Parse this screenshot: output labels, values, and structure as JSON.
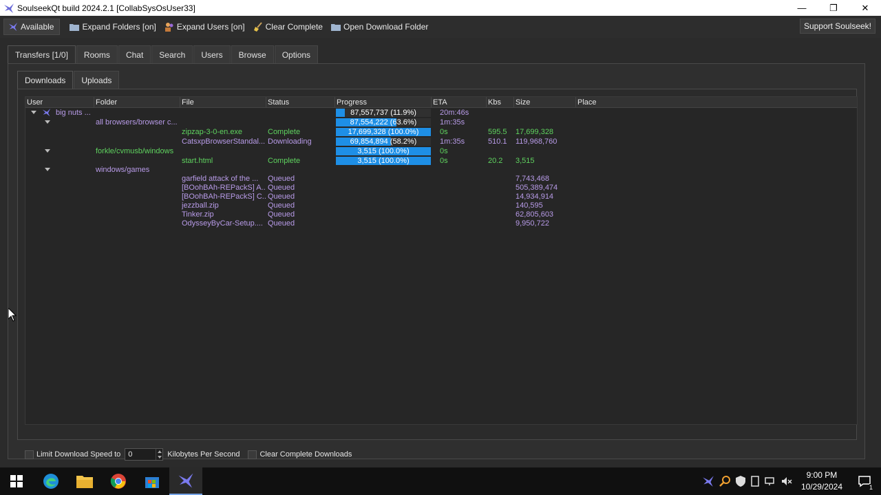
{
  "window": {
    "title": "SoulseekQt build 2024.2.1 [CollabSysOsUser33]",
    "minimize": "—",
    "maximize": "❐",
    "close": "✕"
  },
  "toolbar": {
    "available": "Available",
    "expand_folders": "Expand Folders [on]",
    "expand_users": "Expand Users [on]",
    "clear_complete": "Clear Complete",
    "open_download_folder": "Open Download Folder",
    "support": "Support Soulseek!"
  },
  "tabs": [
    "Transfers [1/0]",
    "Rooms",
    "Chat",
    "Search",
    "Users",
    "Browse",
    "Options"
  ],
  "subtabs": [
    "Downloads",
    "Uploads"
  ],
  "columns": [
    "User",
    "Folder",
    "File",
    "Status",
    "Progress",
    "ETA",
    "Kbs",
    "Size",
    "Place"
  ],
  "rows": [
    {
      "type": "user",
      "user": "big nuts ...",
      "progress_text": "87,557,737 (11.9%)",
      "progress": 0.119,
      "eta": "20m:46s"
    },
    {
      "type": "folder",
      "folder": "all browsers/browser c...",
      "progress_text": "87,554,222 (63.6%)",
      "progress": 0.636,
      "eta": "1m:35s"
    },
    {
      "type": "file",
      "file": "zipzap-3-0-en.exe",
      "status": "Complete",
      "progress_text": "17,699,328 (100.0%)",
      "progress": 1.0,
      "eta": "0s",
      "kbs": "595.5",
      "size": "17,699,328",
      "color": "green"
    },
    {
      "type": "file",
      "file": "CatsxpBrowserStandal...",
      "status": "Downloading",
      "progress_text": "69,854,894 (58.2%)",
      "progress": 0.582,
      "eta": "1m:35s",
      "kbs": "510.1",
      "size": "119,968,760",
      "color": "purple"
    },
    {
      "type": "folder",
      "folder": "forkle/cvmusb/windows",
      "progress_text": "3,515 (100.0%)",
      "progress": 1.0,
      "eta": "0s",
      "color": "green"
    },
    {
      "type": "file",
      "file": "start.html",
      "status": "Complete",
      "progress_text": "3,515 (100.0%)",
      "progress": 1.0,
      "eta": "0s",
      "kbs": "20.2",
      "size": "3,515",
      "color": "green"
    },
    {
      "type": "folder",
      "folder": "windows/games"
    },
    {
      "type": "file",
      "file": "garfield attack of the ...",
      "status": "Queued",
      "size": "7,743,468",
      "color": "purple"
    },
    {
      "type": "file",
      "file": "[BOohBAh-REPackS] A...",
      "status": "Queued",
      "size": "505,389,474",
      "color": "purple"
    },
    {
      "type": "file",
      "file": "[BOohBAh-REPackS] C...",
      "status": "Queued",
      "size": "14,934,914",
      "color": "purple"
    },
    {
      "type": "file",
      "file": "jezzball.zip",
      "status": "Queued",
      "size": "140,595",
      "color": "purple"
    },
    {
      "type": "file",
      "file": "Tinker.zip",
      "status": "Queued",
      "size": "62,805,603",
      "color": "purple"
    },
    {
      "type": "file",
      "file": "OdysseyByCar-Setup....",
      "status": "Queued",
      "size": "9,950,722",
      "color": "purple"
    }
  ],
  "footer": {
    "limit_label": "Limit Download Speed to",
    "speed_value": "0",
    "kbps_label": "Kilobytes Per Second",
    "clear_label": "Clear Complete Downloads"
  },
  "taskbar": {
    "time": "9:00 PM",
    "date": "10/29/2024",
    "notification_count": "1"
  },
  "colors": {
    "progress_fill": "#1e8fe6",
    "complete_text": "#5fd35f",
    "queued_text": "#b89be8"
  }
}
